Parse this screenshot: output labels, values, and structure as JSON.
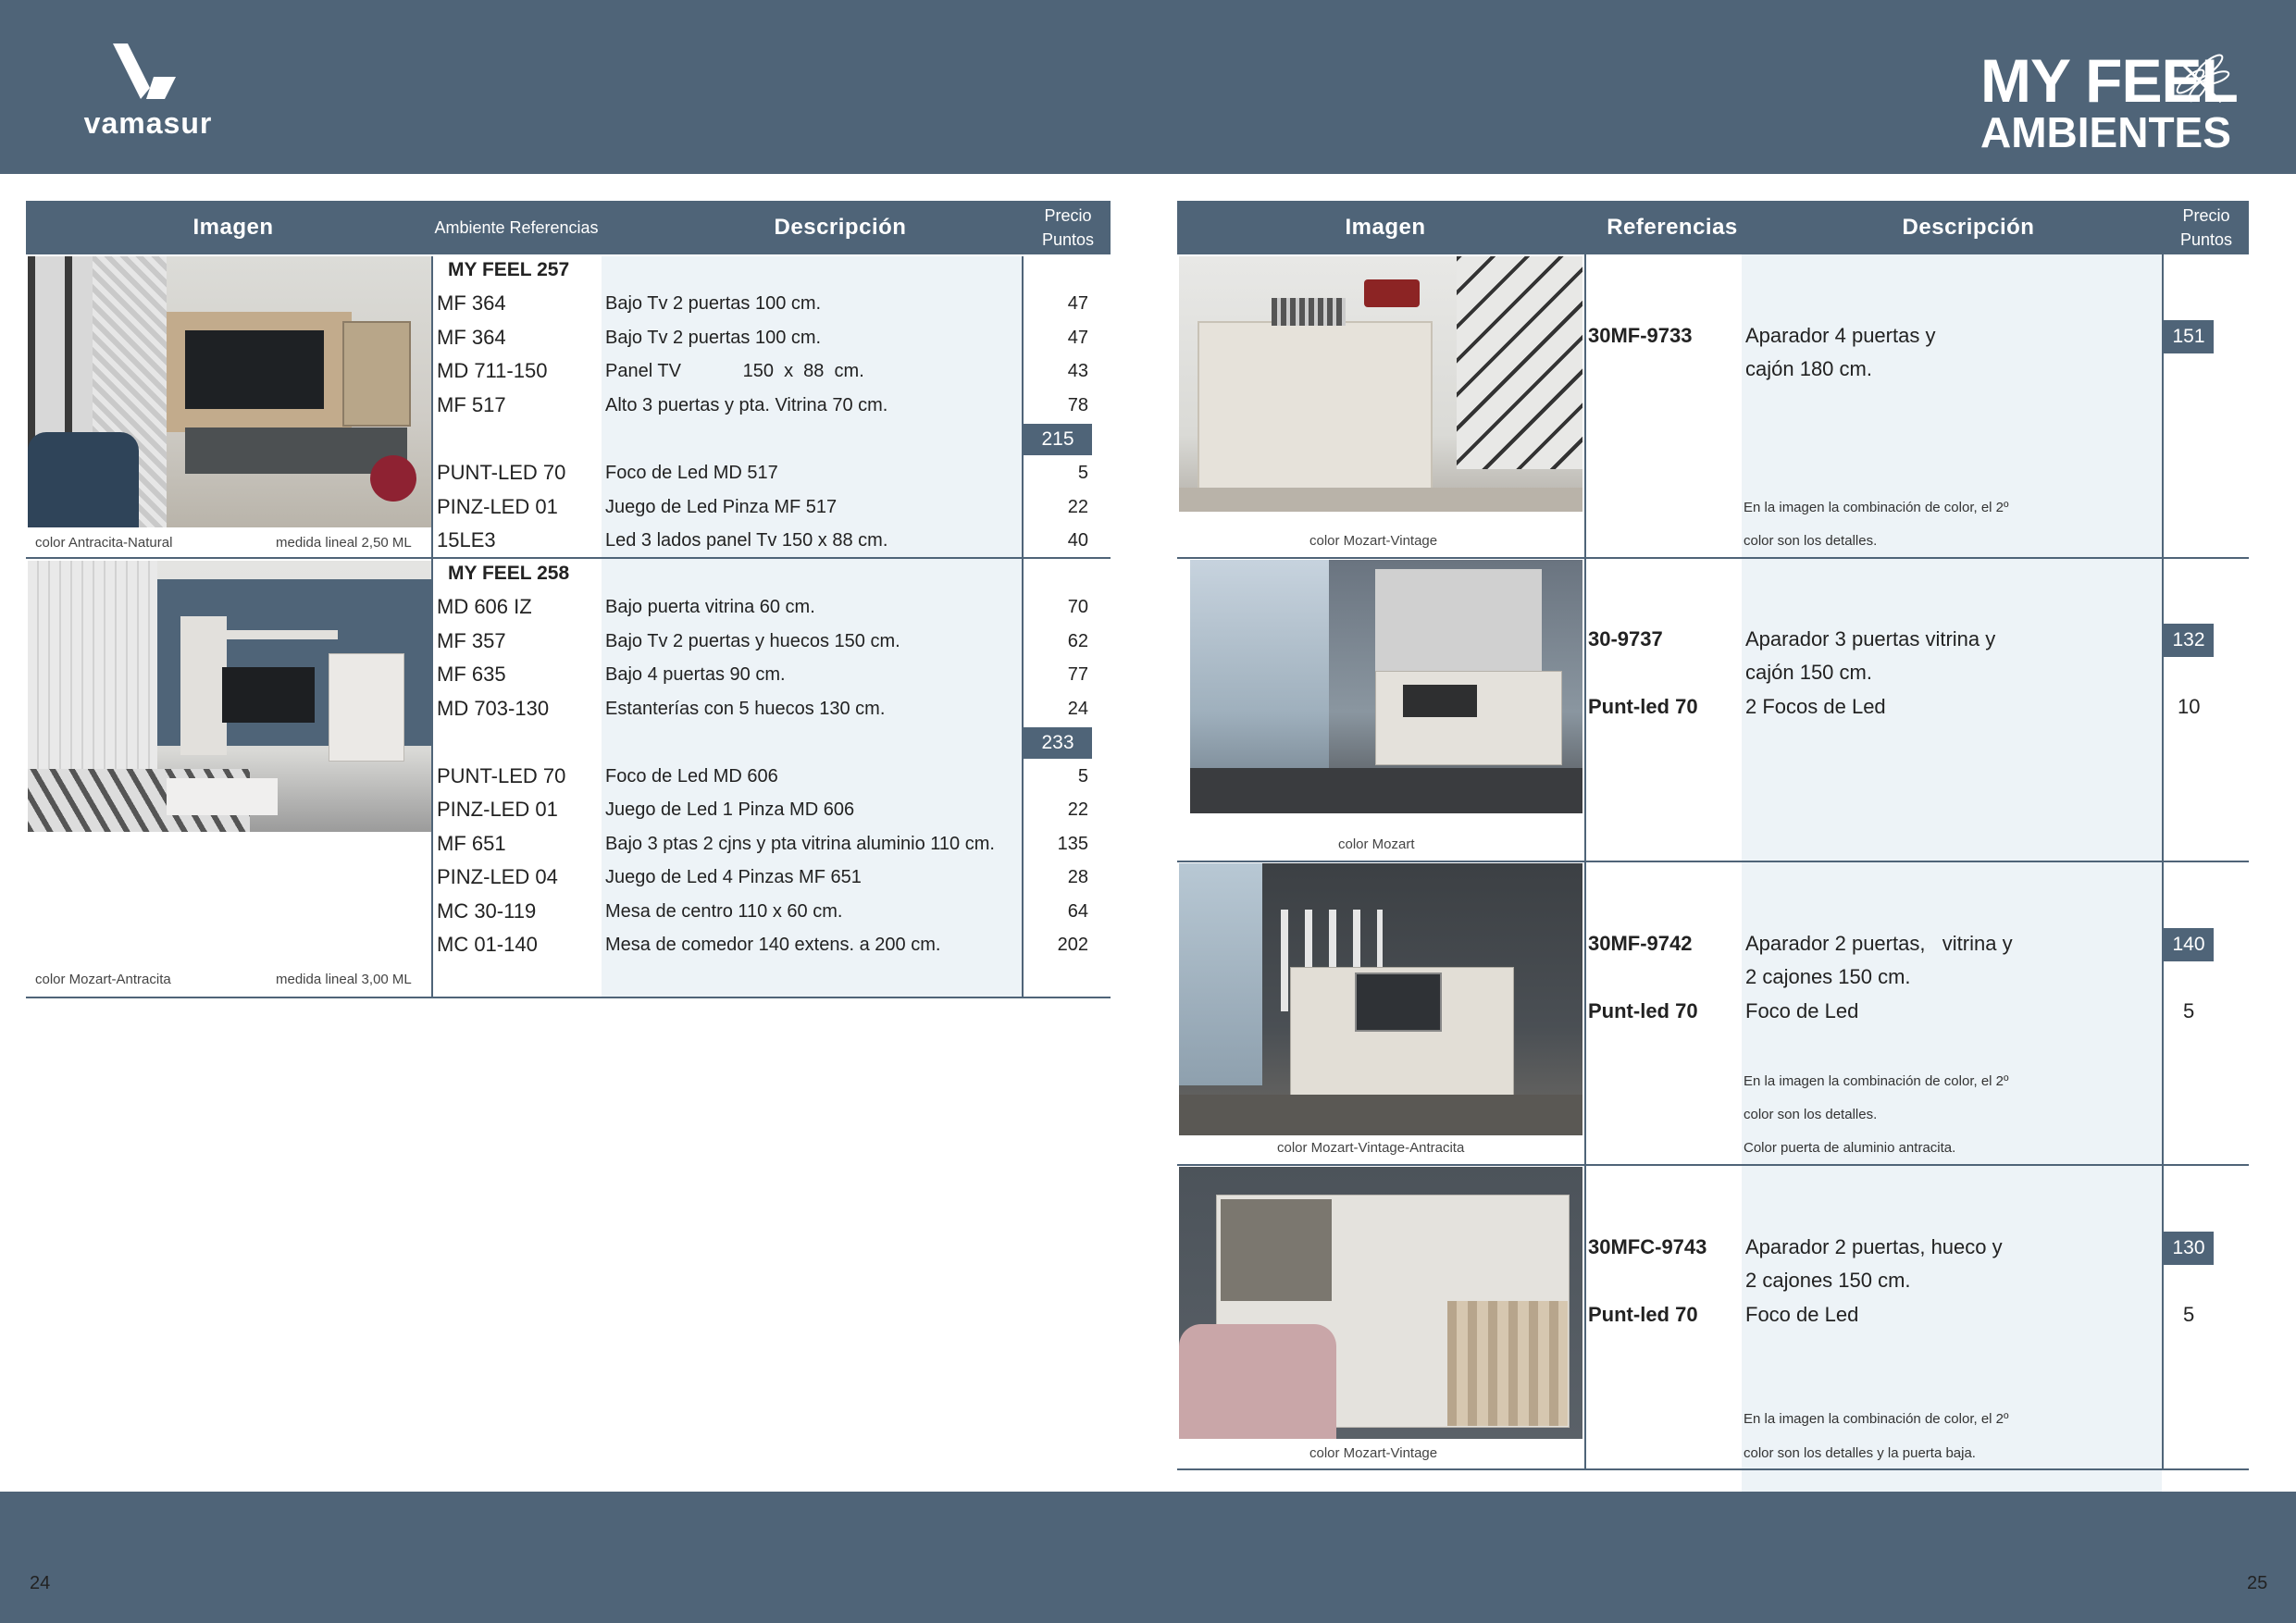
{
  "brand": {
    "logo_text": "vamasur",
    "title_line1": "MY FEEL",
    "title_line2": "AMBIENTES",
    "page_left": "24",
    "page_right": "25"
  },
  "left_table": {
    "headers": {
      "imagen": "Imagen",
      "ambiente": "Ambiente Referencias",
      "descripcion": "Descripción",
      "precio1": "Precio",
      "precio2": "Puntos"
    },
    "groups": [
      {
        "title": "MY FEEL 257",
        "color_caption": "color Antracita-Natural",
        "medida_caption": "medida lineal 2,50 ML",
        "rows": [
          {
            "ref": "MF 364",
            "desc": "Bajo Tv 2 puertas 100 cm.",
            "price": "47"
          },
          {
            "ref": "MF 364",
            "desc": "Bajo Tv 2 puertas 100 cm.",
            "price": "47"
          },
          {
            "ref": "MD 711-150",
            "desc": "Panel TV            150  x  88  cm.",
            "price": "43"
          },
          {
            "ref": "MF 517",
            "desc": "Alto 3 puertas y pta. Vitrina 70  cm.",
            "price": "78"
          }
        ],
        "total": "215",
        "extras": [
          {
            "ref": "PUNT-LED 70",
            "desc": "Foco de Led MD 517",
            "price": "5"
          },
          {
            "ref": "PINZ-LED 01",
            "desc": "Juego de Led Pinza MF 517",
            "price": "22"
          },
          {
            "ref": "15LE3",
            "desc": "Led 3 lados panel Tv 150 x 88 cm.",
            "price": "40"
          }
        ]
      },
      {
        "title": "MY FEEL 258",
        "color_caption": "color Mozart-Antracita",
        "medida_caption": "medida lineal 3,00 ML",
        "rows": [
          {
            "ref": "MD 606 IZ",
            "desc": "Bajo puerta vitrina 60 cm.",
            "price": "70"
          },
          {
            "ref": "MF 357",
            "desc": "Bajo Tv 2 puertas y huecos 150 cm.",
            "price": "62"
          },
          {
            "ref": "MF 635",
            "desc": "Bajo 4 puertas 90 cm.",
            "price": "77"
          },
          {
            "ref": "MD 703-130",
            "desc": "Estanterías con 5 huecos 130 cm.",
            "price": "24"
          }
        ],
        "total": "233",
        "extras": [
          {
            "ref": "PUNT-LED 70",
            "desc": "Foco de Led MD 606",
            "price": "5"
          },
          {
            "ref": "PINZ-LED 01",
            "desc": "Juego de Led 1 Pinza MD 606",
            "price": "22"
          },
          {
            "ref": "MF 651",
            "desc": "Bajo 3 ptas 2 cjns y pta vitrina aluminio 110 cm.",
            "price": "135"
          },
          {
            "ref": "PINZ-LED 04",
            "desc": "Juego de Led 4 Pinzas MF 651",
            "price": "28"
          },
          {
            "ref": "MC 30-119",
            "desc": "Mesa de centro 110 x 60 cm.",
            "price": "64"
          },
          {
            "ref": "MC 01-140",
            "desc": "Mesa de comedor 140 extens. a 200 cm.",
            "price": "202"
          }
        ]
      }
    ]
  },
  "right_table": {
    "headers": {
      "imagen": "Imagen",
      "referencias": "Referencias",
      "descripcion": "Descripción",
      "precio1": "Precio",
      "precio2": "Puntos"
    },
    "items": [
      {
        "ref": "30MF-9733",
        "desc1": "Aparador 4 puertas y",
        "desc2": "cajón 180 cm.",
        "price": "151",
        "led_ref": "",
        "led_desc": "",
        "led_price": "",
        "notes": [
          "En la imagen la combinación de  color,  el  2º",
          "color son los detalles."
        ],
        "caption": "color Mozart-Vintage"
      },
      {
        "ref": "30-9737",
        "desc1": "Aparador 3 puertas vitrina y",
        "desc2": "cajón 150 cm.",
        "price": "132",
        "led_ref": "Punt-led 70",
        "led_desc": "2 Focos de Led",
        "led_price": "10",
        "notes": [],
        "caption": "color Mozart"
      },
      {
        "ref": "30MF-9742",
        "desc1": "Aparador 2 puertas,   vitrina y",
        "desc2": "2 cajones 150 cm.",
        "price": "140",
        "led_ref": "Punt-led 70",
        "led_desc": "Foco de Led",
        "led_price": "5",
        "notes": [
          "En la imagen la combinación de  color,  el  2º",
          "color son los detalles.",
          "Color puerta de aluminio antracita."
        ],
        "caption": "color Mozart-Vintage-Antracita"
      },
      {
        "ref": "30MFC-9743",
        "desc1": "Aparador 2 puertas, hueco y",
        "desc2": "2 cajones 150 cm.",
        "price": "130",
        "led_ref": "Punt-led 70",
        "led_desc": "Foco de Led",
        "led_price": "5",
        "notes": [
          "En la imagen la combinación de  color,  el  2º",
          "color son los detalles y la puerta baja."
        ],
        "caption": "color Mozart-Vintage"
      }
    ]
  }
}
